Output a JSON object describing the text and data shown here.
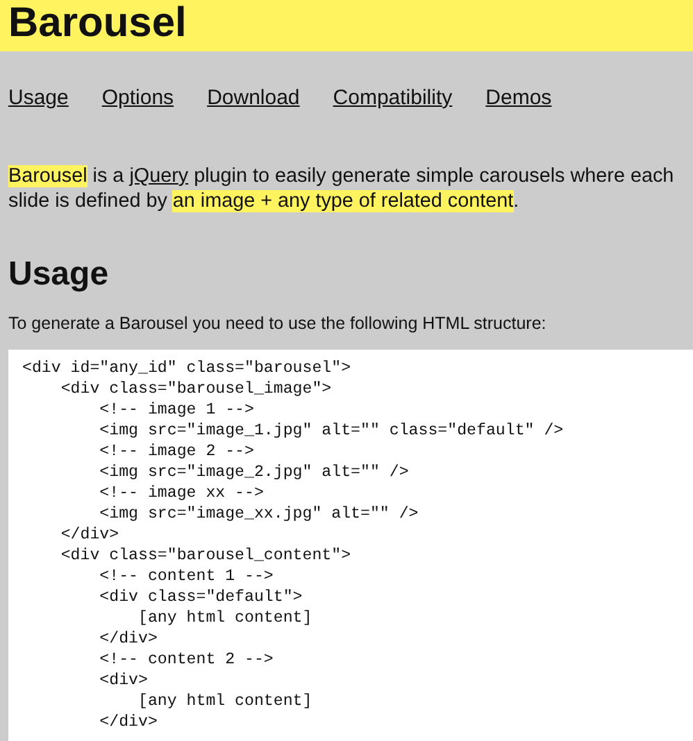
{
  "header": {
    "title": "Barousel"
  },
  "nav": [
    {
      "label": "Usage"
    },
    {
      "label": "Options"
    },
    {
      "label": "Download"
    },
    {
      "label": "Compatibility"
    },
    {
      "label": "Demos"
    }
  ],
  "intro": [
    {
      "kind": "highlight",
      "text": "Barousel"
    },
    {
      "kind": "plain",
      "text": " is a "
    },
    {
      "kind": "link",
      "text": "jQuery"
    },
    {
      "kind": "plain",
      "text": " plugin to easily generate simple carousels where each slide is defined by "
    },
    {
      "kind": "highlight",
      "text": "an image + any type of related content"
    },
    {
      "kind": "plain",
      "text": "."
    }
  ],
  "usage": {
    "heading": "Usage",
    "instruction": "To generate a Barousel you need to use the following HTML structure:",
    "code": [
      "<div id=\"any_id\" class=\"barousel\">",
      "    <div class=\"barousel_image\">",
      "        <!-- image 1 -->",
      "        <img src=\"image_1.jpg\" alt=\"\" class=\"default\" />",
      "        <!-- image 2 -->",
      "        <img src=\"image_2.jpg\" alt=\"\" />",
      "        <!-- image xx -->",
      "        <img src=\"image_xx.jpg\" alt=\"\" />",
      "    </div>",
      "    <div class=\"barousel_content\">",
      "        <!-- content 1 -->",
      "        <div class=\"default\">",
      "            [any html content]",
      "        </div>",
      "        <!-- content 2 -->",
      "        <div>",
      "            [any html content]",
      "        </div>"
    ]
  }
}
